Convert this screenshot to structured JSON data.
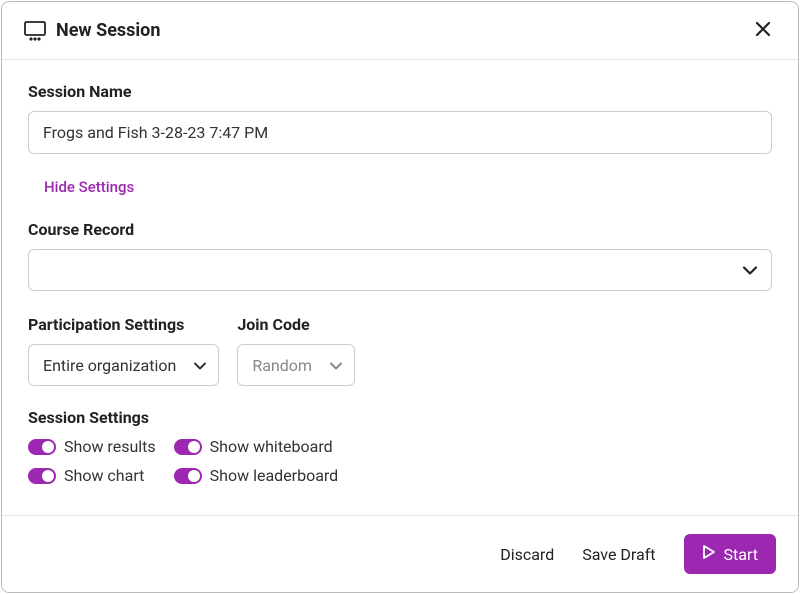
{
  "header": {
    "title": "New Session"
  },
  "session_name": {
    "label": "Session Name",
    "value": "Frogs and Fish 3-28-23 7:47 PM"
  },
  "hide_settings_label": "Hide Settings",
  "course_record": {
    "label": "Course Record",
    "value": ""
  },
  "participation": {
    "label": "Participation Settings",
    "value": "Entire organization"
  },
  "join_code": {
    "label": "Join Code",
    "value": "Random"
  },
  "session_settings": {
    "label": "Session Settings",
    "toggles": {
      "show_results": "Show results",
      "show_whiteboard": "Show whiteboard",
      "show_chart": "Show chart",
      "show_leaderboard": "Show leaderboard"
    }
  },
  "footer": {
    "discard": "Discard",
    "save_draft": "Save Draft",
    "start": "Start"
  }
}
